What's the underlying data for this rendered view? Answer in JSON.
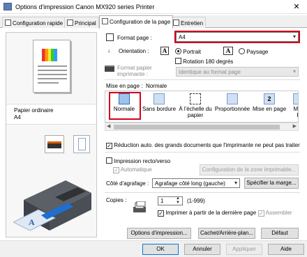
{
  "window": {
    "title": "Options d'impression Canon MX920 series Printer",
    "close_glyph": "✕"
  },
  "tabs": [
    {
      "label": "Configuration rapide"
    },
    {
      "label": "Principal"
    },
    {
      "label": "Configuration de la page"
    },
    {
      "label": "Entretien"
    }
  ],
  "preview": {
    "media_type": "Papier ordinaire",
    "media_size": "A4"
  },
  "page_setup": {
    "format_label": "Format page :",
    "format_value": "A4",
    "orientation_label": "Orientation :",
    "orientation_glyph": "A",
    "portrait": "Portrait",
    "landscape": "Paysage",
    "rotate180": "Rotation 180 degrés",
    "printer_paper_label_1": "Format papier",
    "printer_paper_label_2": "imprimante :",
    "printer_paper_value": "Identique au format page"
  },
  "layout": {
    "label": "Mise en page :",
    "current": "Normale",
    "items": [
      {
        "label": "Normale",
        "label2": ""
      },
      {
        "label": "Sans bordure",
        "label2": ""
      },
      {
        "label": "À l'échelle du",
        "label2": "papier"
      },
      {
        "label": "Proportionnée",
        "label2": ""
      },
      {
        "label": "Mise en page",
        "label2": "",
        "badge": "2"
      },
      {
        "label": "Mos",
        "label2": "P"
      }
    ]
  },
  "reduce_large": "Réduction auto. des grands documents que l'imprimante ne peut pas traiter",
  "duplex": {
    "label": "Impression recto/verso",
    "automatic": "Automatique",
    "config_button": "Configuration de la zone imprimable..."
  },
  "stapling": {
    "label": "Côté d'agrafage :",
    "value": "Agrafage côté long (gauche)",
    "margin_button": "Spécifier la marge..."
  },
  "copies": {
    "label": "Copies :",
    "value": "1",
    "range": "(1-999)",
    "last_page": "Imprimer à partir de la dernière page",
    "collate": "Assembler"
  },
  "page_buttons": {
    "options": "Options d'impression...",
    "stamp": "Cachet/Arrière-plan...",
    "default": "Défaut"
  },
  "dialog_buttons": {
    "ok": "OK",
    "cancel": "Annuler",
    "apply": "Appliquer",
    "help": "Aide"
  },
  "colors": {
    "highlight_red": "#d0021b",
    "selection_blue": "#0078d7"
  }
}
